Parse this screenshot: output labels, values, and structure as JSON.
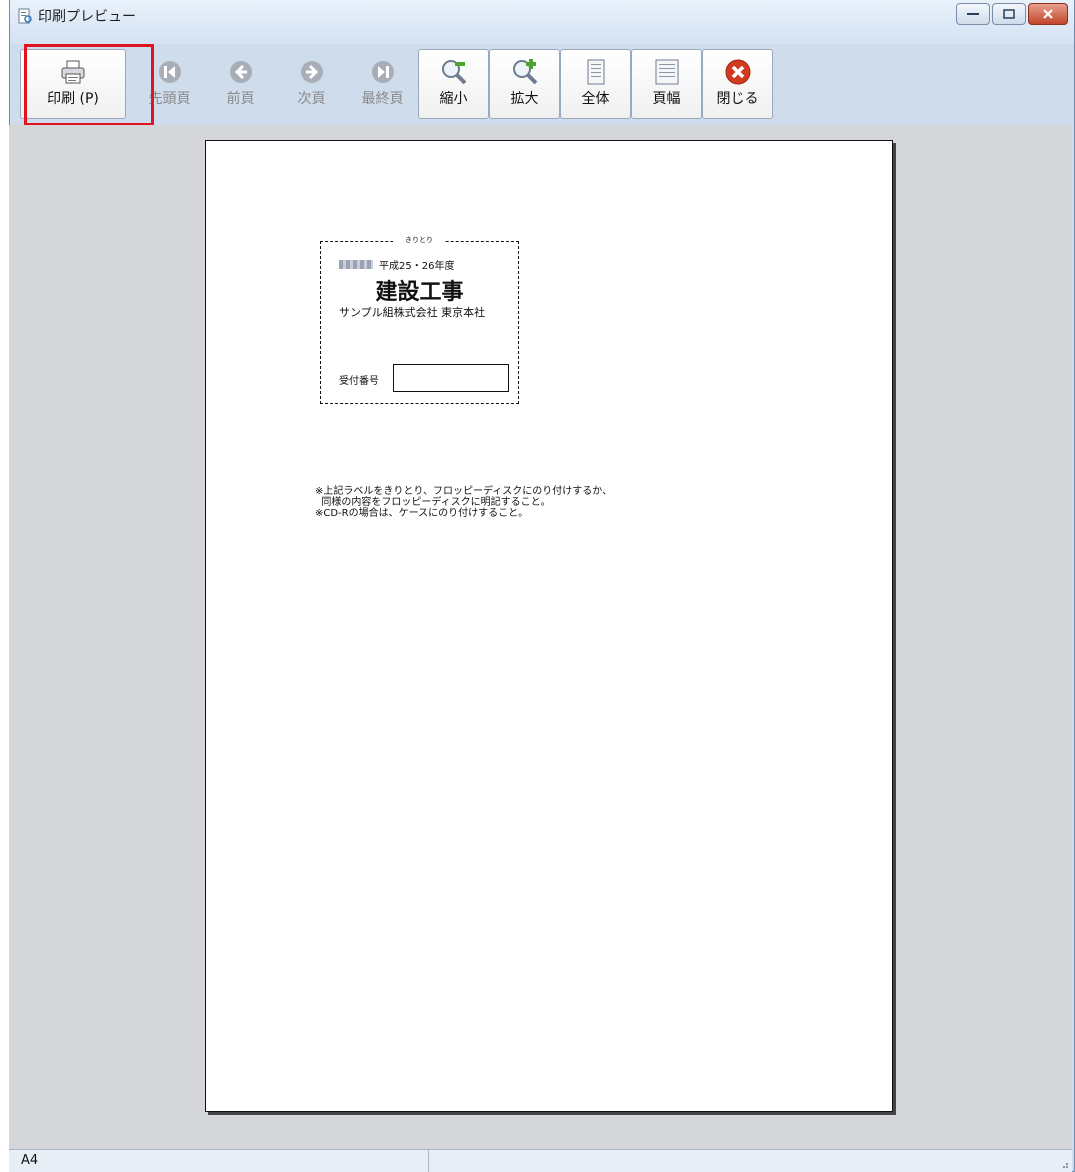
{
  "window": {
    "title": "印刷プレビュー",
    "title_icon": "print-preview-icon"
  },
  "toolbar": {
    "print_label": "印刷 (P)",
    "first_label": "先頭頁",
    "prev_label": "前頁",
    "next_label": "次頁",
    "last_label": "最終頁",
    "zoom_out_label": "縮小",
    "zoom_in_label": "拡大",
    "whole_label": "全体",
    "page_width_label": "頁幅",
    "close_label": "閉じる"
  },
  "page": {
    "cut_line_label": "きりとり",
    "small_line": "平成25・26年度",
    "big_title": "建設工事",
    "company": "サンプル組株式会社 東京本社",
    "reference_label": "受付番号",
    "note_line1": "※上記ラベルをきりとり、フロッピーディスクにのり付けするか、",
    "note_line2": "  同様の内容をフロッピーディスクに明記すること。",
    "note_line3": "※CD-Rの場合は、ケースにのり付けすること。"
  },
  "status": {
    "paper_size": "A4"
  },
  "colors": {
    "highlight": "#e0141e",
    "close_button": "#d23a22",
    "window_bg": "#cfdcec"
  }
}
